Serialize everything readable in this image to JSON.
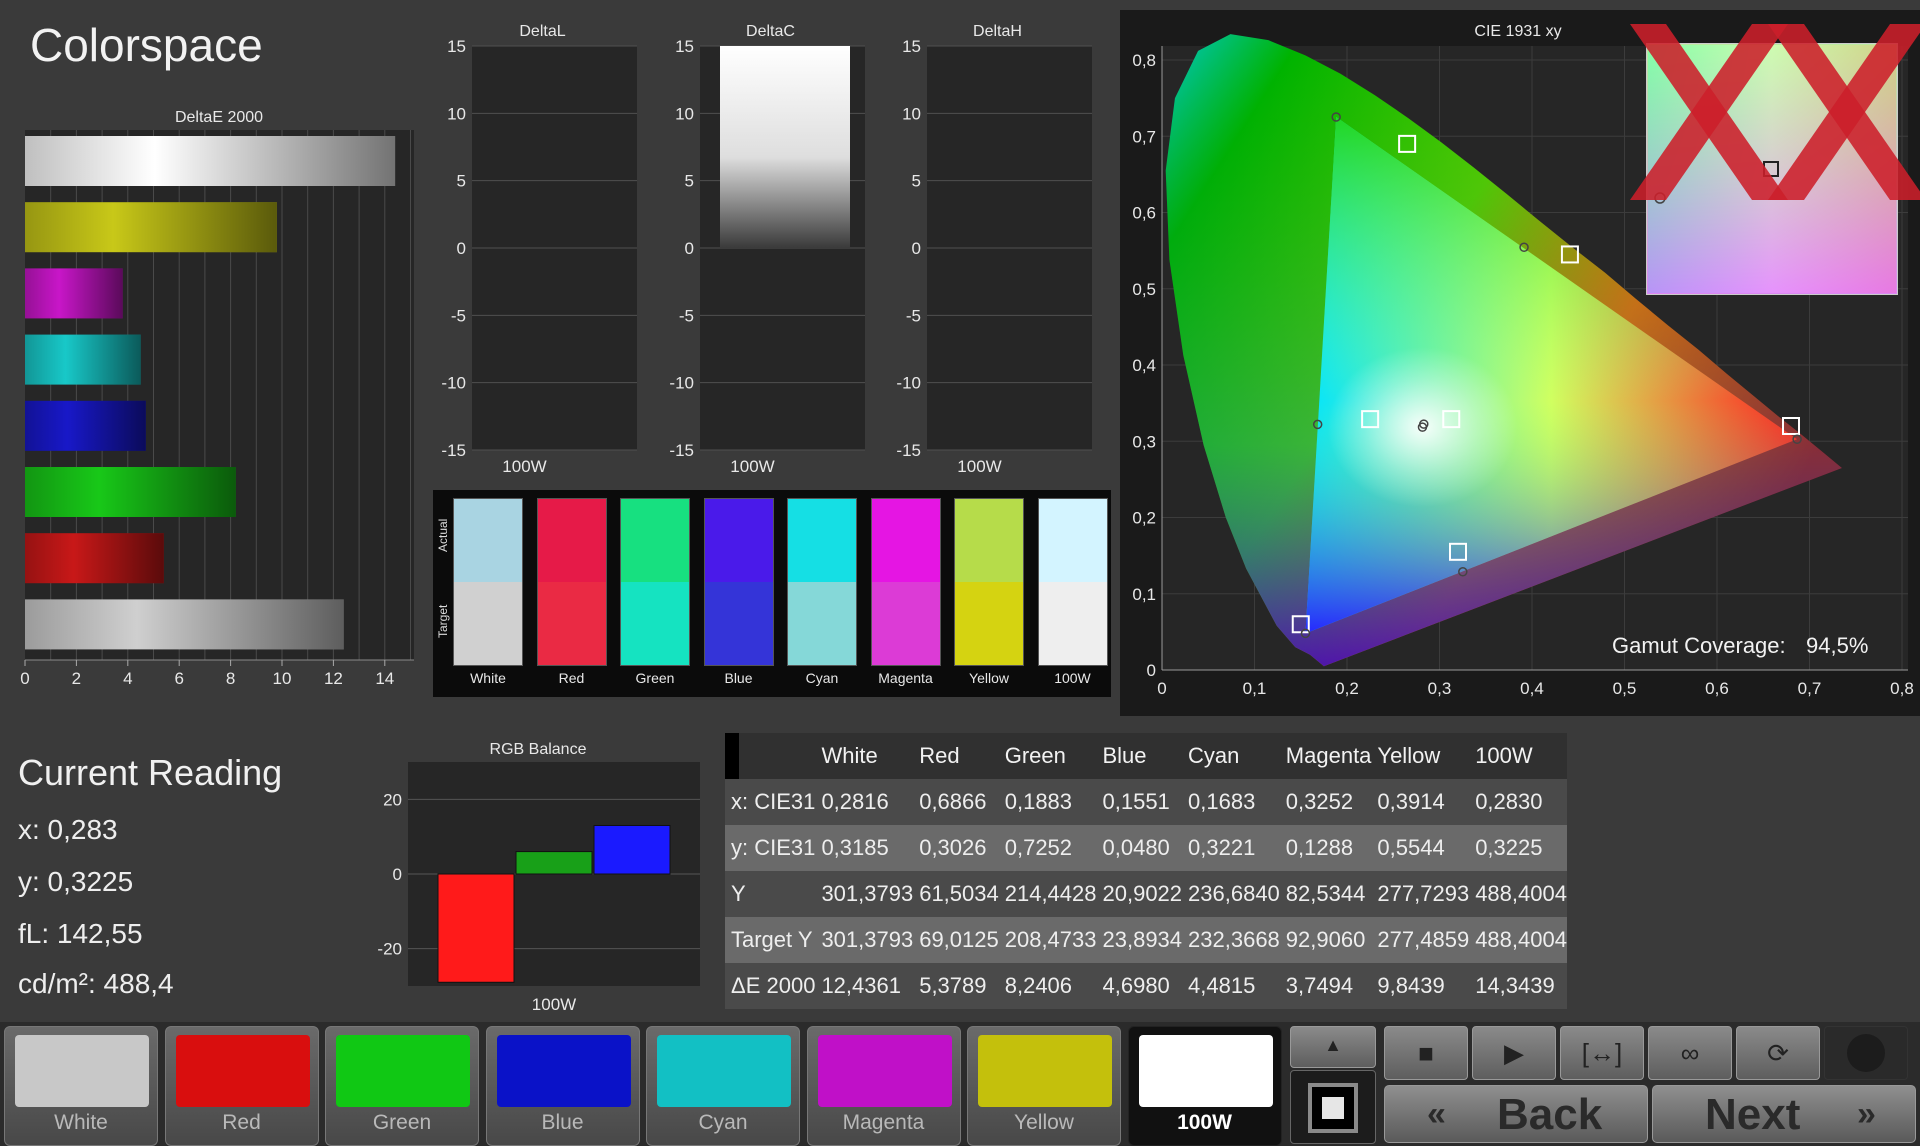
{
  "app_title": "Colorspace",
  "deltae_chart": {
    "title": "DeltaE 2000",
    "x_ticks": [
      "0",
      "2",
      "4",
      "6",
      "8",
      "10",
      "12",
      "14"
    ]
  },
  "delta_charts": [
    {
      "title": "DeltaL",
      "xlabel": "100W"
    },
    {
      "title": "DeltaC",
      "xlabel": "100W"
    },
    {
      "title": "DeltaH",
      "xlabel": "100W"
    }
  ],
  "delta_y_ticks": [
    "15",
    "10",
    "5",
    "0",
    "-5",
    "-10",
    "-15"
  ],
  "swatches": {
    "actual_label": "Actual",
    "target_label": "Target",
    "items": [
      {
        "label": "White",
        "actual": "#a9d4e2",
        "target": "#d0d0d0"
      },
      {
        "label": "Red",
        "actual": "#e61a48",
        "target": "#ea2a44"
      },
      {
        "label": "Green",
        "actual": "#17e080",
        "target": "#15e3c1"
      },
      {
        "label": "Blue",
        "actual": "#4a1aea",
        "target": "#3434d8"
      },
      {
        "label": "Cyan",
        "actual": "#15dfe4",
        "target": "#85d8d8"
      },
      {
        "label": "Magenta",
        "actual": "#e515e3",
        "target": "#dc3bd6"
      },
      {
        "label": "Yellow",
        "actual": "#b6dc4a",
        "target": "#d5d311"
      },
      {
        "label": "100W",
        "actual": "#d3f4ff",
        "target": "#eeeeee"
      }
    ]
  },
  "cie": {
    "title": "CIE 1931 xy",
    "x_ticks": [
      "0",
      "0,1",
      "0,2",
      "0,3",
      "0,4",
      "0,5",
      "0,6",
      "0,7",
      "0,8"
    ],
    "y_ticks": [
      "0",
      "0,1",
      "0,2",
      "0,3",
      "0,4",
      "0,5",
      "0,6",
      "0,7",
      "0,8"
    ],
    "gamut_label": "Gamut Coverage:",
    "gamut_value": "94,5%"
  },
  "current_reading": {
    "title": "Current Reading",
    "x": "x: 0,283",
    "y": "y: 0,3225",
    "fl": "fL: 142,55",
    "cd": "cd/m²: 488,4"
  },
  "rgb_balance": {
    "title": "RGB Balance",
    "y_ticks": [
      "20",
      "0",
      "-20"
    ],
    "xlabel": "100W"
  },
  "table": {
    "headers": [
      "",
      "White",
      "Red",
      "Green",
      "Blue",
      "Cyan",
      "Magenta",
      "Yellow",
      "100W"
    ],
    "rows": [
      [
        "x: CIE31",
        "0,2816",
        "0,6866",
        "0,1883",
        "0,1551",
        "0,1683",
        "0,3252",
        "0,3914",
        "0,2830"
      ],
      [
        "y: CIE31",
        "0,3185",
        "0,3026",
        "0,7252",
        "0,0480",
        "0,3221",
        "0,1288",
        "0,5544",
        "0,3225"
      ],
      [
        "Y",
        "301,3793",
        "61,5034",
        "214,4428",
        "20,9022",
        "236,6840",
        "82,5344",
        "277,7293",
        "488,4004"
      ],
      [
        "Target Y",
        "301,3793",
        "69,0125",
        "208,4733",
        "23,8934",
        "232,3668",
        "92,9060",
        "277,4859",
        "488,4004"
      ],
      [
        "ΔE 2000",
        "12,4361",
        "5,3789",
        "8,2406",
        "4,6980",
        "4,4815",
        "3,7494",
        "9,8439",
        "14,3439"
      ]
    ]
  },
  "color_buttons": [
    {
      "label": "White",
      "color": "#c8c8c8"
    },
    {
      "label": "Red",
      "color": "#d90e0e"
    },
    {
      "label": "Green",
      "color": "#10c814"
    },
    {
      "label": "Blue",
      "color": "#0a12c8"
    },
    {
      "label": "Cyan",
      "color": "#12c0c4"
    },
    {
      "label": "Magenta",
      "color": "#c010c8"
    },
    {
      "label": "Yellow",
      "color": "#c4c00c"
    },
    {
      "label": "100W",
      "color": "#ffffff"
    }
  ],
  "nav": {
    "back": "Back",
    "next": "Next"
  },
  "chart_data": [
    {
      "type": "bar",
      "title": "DeltaE 2000",
      "orientation": "horizontal",
      "categories": [
        "White",
        "Yellow",
        "Magenta",
        "Cyan",
        "Blue",
        "Green",
        "Red",
        "100W"
      ],
      "values": [
        14.4,
        9.8,
        3.8,
        4.5,
        4.7,
        8.2,
        5.4,
        12.4
      ],
      "colors": [
        "#ffffff",
        "#c8c818",
        "#c816c8",
        "#18c8c8",
        "#1818c8",
        "#18c818",
        "#c81818",
        "#cfcfcf"
      ],
      "xlim": [
        0,
        15
      ]
    },
    {
      "type": "bar",
      "title": "DeltaL",
      "categories": [
        "100W"
      ],
      "values": [
        0
      ],
      "ylim": [
        -15,
        15
      ]
    },
    {
      "type": "bar",
      "title": "DeltaC",
      "categories": [
        "100W"
      ],
      "values": [
        15
      ],
      "ylim": [
        -15,
        15
      ]
    },
    {
      "type": "bar",
      "title": "DeltaH",
      "categories": [
        "100W"
      ],
      "values": [
        0
      ],
      "ylim": [
        -15,
        15
      ]
    },
    {
      "type": "bar",
      "title": "RGB Balance",
      "categories": [
        "100W"
      ],
      "series": [
        {
          "color": "#ff1a1a",
          "values": [
            -29
          ]
        },
        {
          "color": "#18a018",
          "values": [
            6
          ]
        },
        {
          "color": "#1a1aff",
          "values": [
            13
          ]
        }
      ],
      "ylim": [
        -30,
        30
      ]
    },
    {
      "type": "scatter",
      "title": "CIE 1931 xy",
      "xlim": [
        0,
        0.8
      ],
      "ylim": [
        0,
        0.8
      ],
      "target_points": [
        {
          "name": "Red",
          "x": 0.68,
          "y": 0.32
        },
        {
          "name": "Green",
          "x": 0.265,
          "y": 0.69
        },
        {
          "name": "Blue",
          "x": 0.15,
          "y": 0.06
        },
        {
          "name": "Cyan",
          "x": 0.225,
          "y": 0.329
        },
        {
          "name": "Magenta",
          "x": 0.32,
          "y": 0.155
        },
        {
          "name": "Yellow",
          "x": 0.441,
          "y": 0.545
        },
        {
          "name": "White",
          "x": 0.3127,
          "y": 0.329
        }
      ],
      "measured_points": [
        {
          "name": "Red",
          "x": 0.6866,
          "y": 0.3026
        },
        {
          "name": "Green",
          "x": 0.1883,
          "y": 0.7252
        },
        {
          "name": "Blue",
          "x": 0.1551,
          "y": 0.048
        },
        {
          "name": "Cyan",
          "x": 0.1683,
          "y": 0.3221
        },
        {
          "name": "Magenta",
          "x": 0.3252,
          "y": 0.1288
        },
        {
          "name": "Yellow",
          "x": 0.3914,
          "y": 0.5544
        },
        {
          "name": "White",
          "x": 0.2816,
          "y": 0.3185
        },
        {
          "name": "100W",
          "x": 0.283,
          "y": 0.3225
        }
      ]
    }
  ]
}
